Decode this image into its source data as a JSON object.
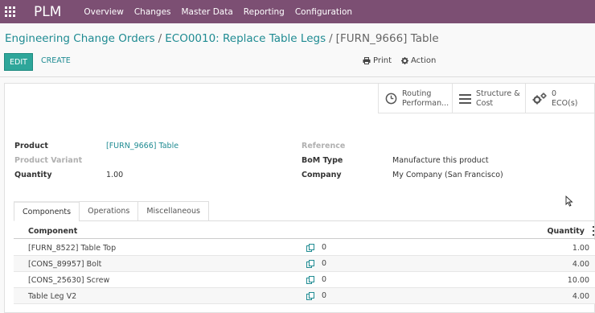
{
  "navbar": {
    "brand": "PLM",
    "menu": [
      "Overview",
      "Changes",
      "Master Data",
      "Reporting",
      "Configuration"
    ]
  },
  "breadcrumb": {
    "items": [
      "Engineering Change Orders",
      "ECO0010: Replace Table Legs"
    ],
    "current": "[FURN_9666] Table",
    "separator": "/"
  },
  "controls": {
    "edit": "EDIT",
    "create": "CREATE",
    "print": "Print",
    "action": "Action"
  },
  "smart_buttons": {
    "routing": [
      "Routing",
      "Performan..."
    ],
    "structure": [
      "Structure &",
      "Cost"
    ],
    "eco": [
      "0",
      "ECO(s)"
    ]
  },
  "form": {
    "left": [
      {
        "label": "Product",
        "value": "[FURN_9666] Table"
      },
      {
        "label": "Product Variant",
        "value": ""
      },
      {
        "label": "Quantity",
        "value": "1.00"
      }
    ],
    "right": [
      {
        "label": "Reference",
        "value": ""
      },
      {
        "label": "BoM Type",
        "value": "Manufacture this product"
      },
      {
        "label": "Company",
        "value": "My Company (San Francisco)"
      }
    ]
  },
  "tabs": [
    "Components",
    "Operations",
    "Miscellaneous"
  ],
  "table": {
    "headers": {
      "component": "Component",
      "quantity": "Quantity"
    },
    "rows": [
      {
        "component": "[FURN_8522] Table Top",
        "available": "0",
        "quantity": "1.00"
      },
      {
        "component": "[CONS_89957] Bolt",
        "available": "0",
        "quantity": "4.00"
      },
      {
        "component": "[CONS_25630] Screw",
        "available": "0",
        "quantity": "10.00"
      },
      {
        "component": "Table Leg V2",
        "available": "0",
        "quantity": "4.00"
      }
    ]
  },
  "colors": {
    "navbar": "#7c4f73",
    "primary_button": "#2ea69a",
    "link": "#1f8b92"
  }
}
